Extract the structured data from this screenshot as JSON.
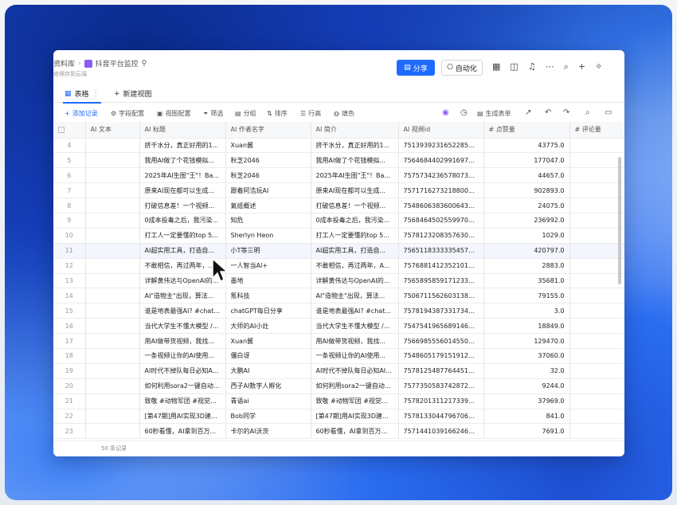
{
  "breadcrumb": {
    "root": "资料库",
    "separator": "›",
    "current": "抖音平台监控",
    "pin_icon": "pin-icon",
    "subtitle": "修保存到云端"
  },
  "top_actions": {
    "share_label": "分享",
    "automation_label": "自动化",
    "icons": [
      "form-icon",
      "copy-icon",
      "bell-icon",
      "more-icon",
      "search-icon",
      "plus-icon",
      "sparkle-icon"
    ]
  },
  "tabs": {
    "active_label": "表格",
    "new_view_label": "新建视图"
  },
  "toolbar": {
    "add_record": "添加记录",
    "field_config": "字段配置",
    "view_config": "视图配置",
    "filter": "筛选",
    "group": "分组",
    "sort": "排序",
    "row_height": "行高",
    "fill_color": "填色",
    "generate_form": "生成表单"
  },
  "columns": [
    "",
    "AI 文本",
    "AI 标题",
    "AI 作者名字",
    "AI 简介",
    "AI 视频id",
    "# 点赞量",
    "# 评论量"
  ],
  "rows": [
    {
      "n": "4",
      "title": "挤干水分，真正好用的1...",
      "author": "Xuan酱",
      "intro": "挤干水分，真正好用的1...",
      "vid": "7513939231652285730",
      "likes": "43775.0"
    },
    {
      "n": "5",
      "title": "我用AI做了个花钱模拟...",
      "author": "秋芝2046",
      "intro": "我用AI做了个花钱模拟...",
      "vid": "7564684402991697190",
      "likes": "177047.0"
    },
    {
      "n": "6",
      "title": "2025年AI生图\"王\"！Ba...",
      "author": "秋芝2046",
      "intro": "2025年AI生图\"王\"！Ba...",
      "vid": "7575734236578073892",
      "likes": "44657.0"
    },
    {
      "n": "7",
      "title": "原来AI现在都可以生成...",
      "author": "跟着阿浩玩AI",
      "intro": "原来AI现在都可以生成...",
      "vid": "7571716273218800946",
      "likes": "902893.0"
    },
    {
      "n": "8",
      "title": "打破信息差！一个视频...",
      "author": "氣纸概述",
      "intro": "打破信息差！一个视频...",
      "vid": "7548606383600643618",
      "likes": "24075.0"
    },
    {
      "n": "9",
      "title": "0成本投毒之后，我污染...",
      "author": "知危",
      "intro": "0成本投毒之后，我污染...",
      "vid": "7568464502559970879",
      "likes": "236992.0"
    },
    {
      "n": "10",
      "title": "打工人一定要懂的top 5...",
      "author": "Sherlyn Heon",
      "intro": "打工人一定要懂的top 5...",
      "vid": "7578123208357630554",
      "likes": "1029.0"
    },
    {
      "n": "11",
      "title": "AI超实用工具，打造自...",
      "author": "小T等三明",
      "intro": "AI超实用工具，打造自...",
      "vid": "7565118333335457033",
      "likes": "420797.0"
    },
    {
      "n": "12",
      "title": "不敢相信，再过两年，...",
      "author": "一人智当AI+",
      "intro": "不敢相信，再过两年，A...",
      "vid": "7576881412352101668",
      "likes": "2883.0"
    },
    {
      "n": "13",
      "title": "详解黄伟达与OpenAI的...",
      "author": "墨地",
      "intro": "详解黄伟达与OpenAI的...",
      "vid": "7565895859171233074",
      "likes": "35681.0"
    },
    {
      "n": "14",
      "title": "AI\"造物主\"出现，算法...",
      "author": "氪科技",
      "intro": "AI\"造物主\"出现，算法...",
      "vid": "7506711562603138344",
      "likes": "79155.0"
    },
    {
      "n": "15",
      "title": "谁是地表最强AI? #chat...",
      "author": "chatGPT每日分享",
      "intro": "谁是地表最强AI? #chat...",
      "vid": "7578194387331734770",
      "likes": "3.0"
    },
    {
      "n": "16",
      "title": "当代大学生不懂大模型 /...",
      "author": "大师的AI小灶",
      "intro": "当代大学生不懂大模型 /...",
      "vid": "7547541965689146624",
      "likes": "18849.0"
    },
    {
      "n": "17",
      "title": "用AI做带货视频，我找...",
      "author": "Xuan酱",
      "intro": "用AI做带货视频，我找...",
      "vid": "7566985556014550278",
      "likes": "129470.0"
    },
    {
      "n": "18",
      "title": "一条视频让你的AI使用...",
      "author": "僵白讶",
      "intro": "一条视频让你的AI使用...",
      "vid": "7548605179151912251",
      "likes": "37060.0"
    },
    {
      "n": "19",
      "title": "AI时代不掉队每日必知AI...",
      "author": "大鹏AI",
      "intro": "AI时代不掉队每日必知AI...",
      "vid": "7578125487764451058",
      "likes": "32.0"
    },
    {
      "n": "20",
      "title": "如何利用sora2一键自动...",
      "author": "西子AI数字人孵化",
      "intro": "如何利用sora2一键自动...",
      "vid": "7577350583742872433",
      "likes": "9244.0"
    },
    {
      "n": "21",
      "title": "致敬 #动物军团 #视觉震...",
      "author": "青语ai",
      "intro": "致敬 #动物军团 #视觉震...",
      "vid": "7578201311217339883",
      "likes": "37969.0"
    },
    {
      "n": "22",
      "title": "[第47期]用AI实现3D建...",
      "author": "Bob同学",
      "intro": "[第47期]用AI实现3D建...",
      "vid": "7578133044796706088",
      "likes": "841.0"
    },
    {
      "n": "23",
      "title": "60秒看懂，AI拿到百万...",
      "author": "卡尔的AI沃茨",
      "intro": "60秒看懂，AI拿到百万...",
      "vid": "7571441039166246720",
      "likes": "7691.0"
    }
  ],
  "footer": {
    "record_count": "50 条记录"
  },
  "colors": {
    "accent": "#1f6bff",
    "app_icon": "#8a5cf6"
  }
}
